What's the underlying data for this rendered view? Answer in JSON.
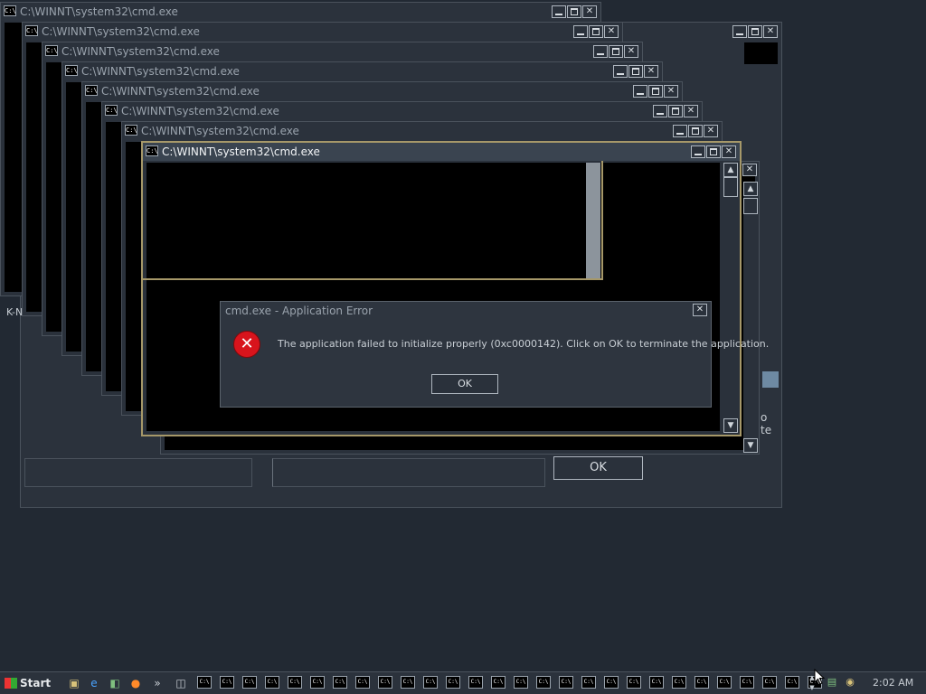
{
  "window_title": "C:\\WINNT\\system32\\cmd.exe",
  "cmd_icon_text": "C:\\",
  "back_panel": {
    "ok_label": "OK",
    "side_label": "K-N",
    "clipped_text": "o te"
  },
  "dialog": {
    "title": "cmd.exe - Application Error",
    "message": "The application failed to initialize properly (0xc0000142). Click on OK to terminate the application.",
    "ok_label": "OK",
    "icon": "error-x-icon"
  },
  "taskbar": {
    "start_label": "Start",
    "chevron": "»",
    "clock": "2:02 AM",
    "button_count": 28
  },
  "colors": {
    "desktop": "#222933",
    "active_border": "#a69869",
    "error_red": "#d8141c"
  }
}
